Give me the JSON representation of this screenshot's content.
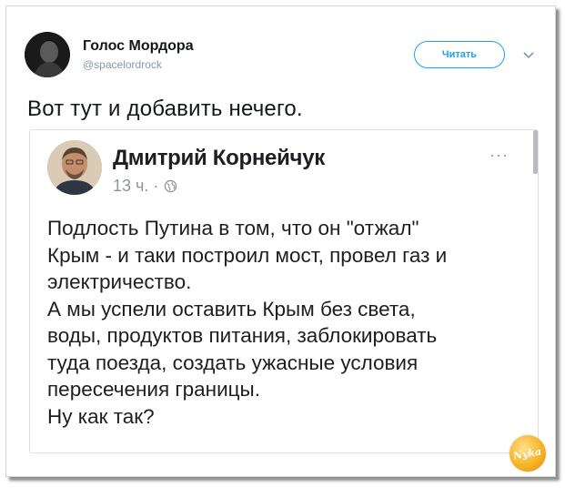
{
  "tweet": {
    "author_name": "Голос Мордора",
    "author_handle": "@spacelordrock",
    "follow_label": "Читать",
    "text": "Вот тут и добавить нечего."
  },
  "embedded_post": {
    "author_name": "Дмитрий Корнейчук",
    "time": "13 ч. ·",
    "more_label": "···",
    "body_lines": [
      "Подлость Путина в том, что он \"отжал\"",
      "Крым - и таки построил мост, провел газ и",
      "электричество.",
      "А мы успели оставить Крым без света,",
      "воды, продуктов питания, заблокировать",
      "туда поезда, создать ужасные условия",
      "пересечения границы.",
      "Ну как так?"
    ]
  },
  "icons": {
    "chevron": "chevron-down-icon",
    "globe": "globe-icon"
  },
  "colors": {
    "accent": "#1da1f2",
    "muted": "#8899a6",
    "text": "#14171a"
  },
  "watermark_text": "Nyka"
}
